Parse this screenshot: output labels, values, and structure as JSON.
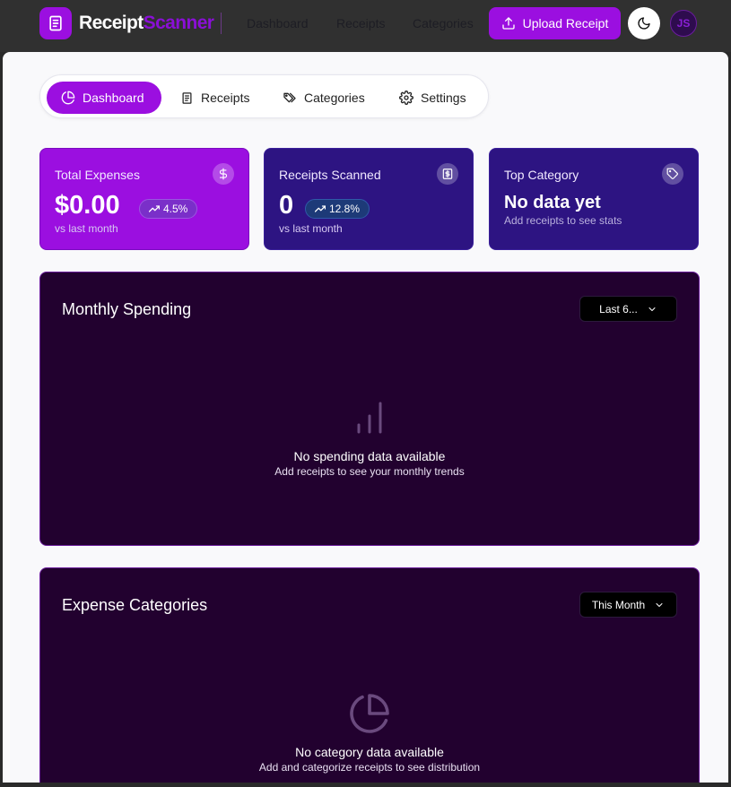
{
  "brand": {
    "part1": "Receipt",
    "part2": "Scanner"
  },
  "top_nav": [
    {
      "label": "Dashboard"
    },
    {
      "label": "Receipts"
    },
    {
      "label": "Categories"
    }
  ],
  "header": {
    "upload_label": "Upload Receipt",
    "avatar_initials": "JS"
  },
  "tabs": [
    {
      "label": "Dashboard",
      "icon": "pie-chart-icon",
      "active": true
    },
    {
      "label": "Receipts",
      "icon": "receipt-icon",
      "active": false
    },
    {
      "label": "Categories",
      "icon": "tags-icon",
      "active": false
    },
    {
      "label": "Settings",
      "icon": "gear-icon",
      "active": false
    }
  ],
  "stats": {
    "total_expenses": {
      "title": "Total Expenses",
      "value": "$0.00",
      "change": "4.5%",
      "sub": "vs last month",
      "icon": "dollar-icon"
    },
    "receipts_scanned": {
      "title": "Receipts Scanned",
      "value": "0",
      "change": "12.8%",
      "sub": "vs last month",
      "icon": "receipt-icon"
    },
    "top_category": {
      "title": "Top Category",
      "value": "No data yet",
      "sub": "Add receipts to see stats",
      "icon": "tag-icon"
    }
  },
  "monthly_spending": {
    "title": "Monthly Spending",
    "select_value": "Last 6...",
    "empty_title": "No spending data available",
    "empty_sub": "Add receipts to see your monthly trends"
  },
  "expense_categories": {
    "title": "Expense Categories",
    "select_value": "This Month",
    "empty_title": "No category data available",
    "empty_sub": "Add and categorize receipts to see distribution"
  },
  "colors": {
    "accent": "#9b0fe0",
    "card_dark": "#2d1482",
    "panel_bg": "#22012f"
  }
}
